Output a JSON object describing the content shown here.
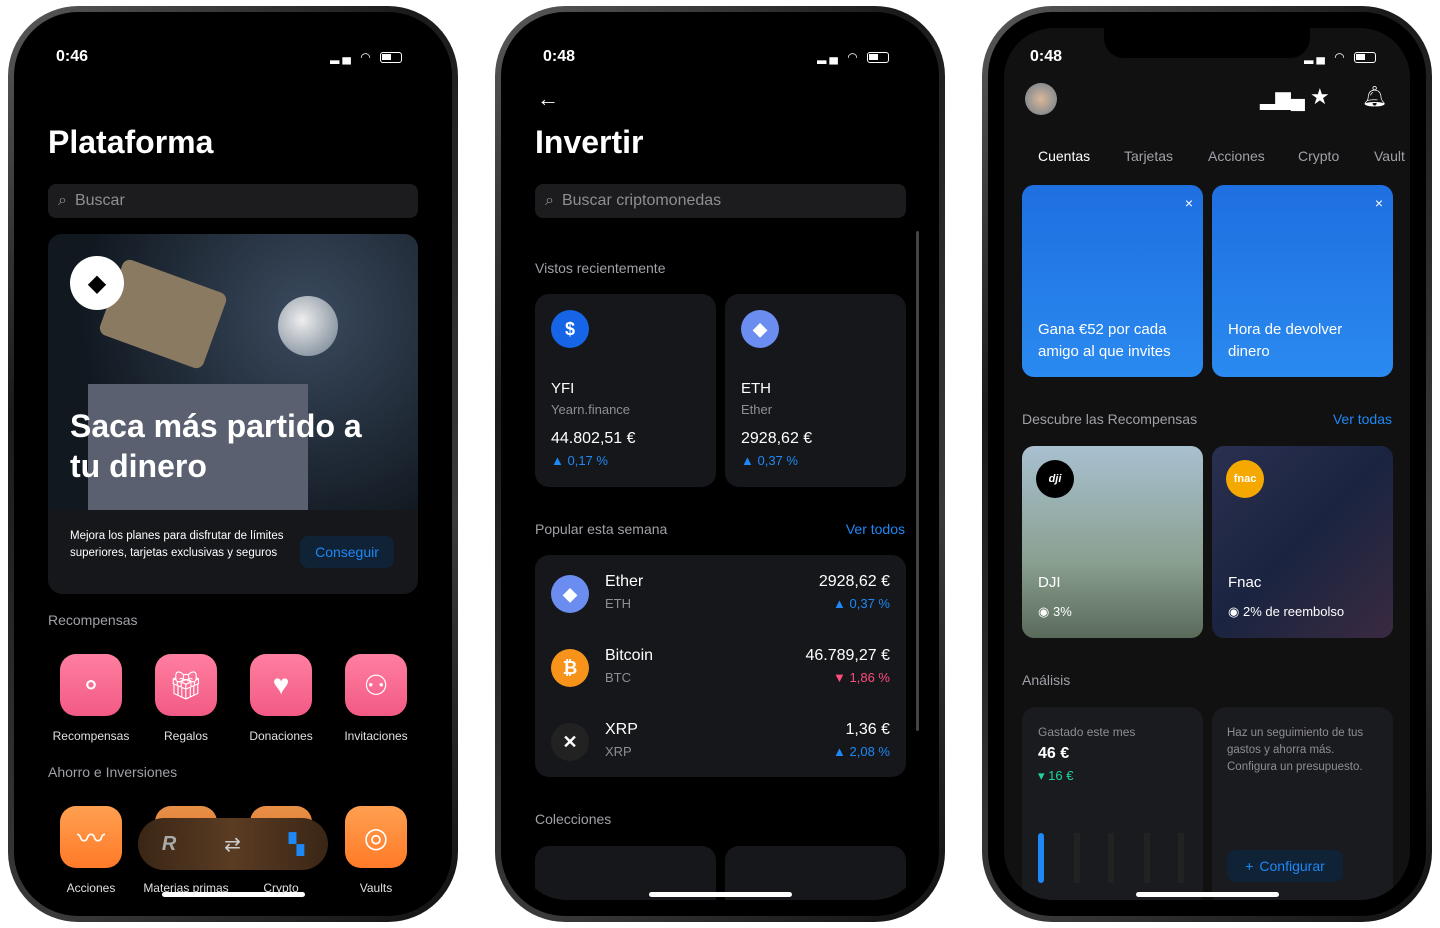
{
  "phone1": {
    "time": "0:46",
    "title": "Plataforma",
    "search_placeholder": "Buscar",
    "hero": {
      "headline": "Saca más partido a tu dinero",
      "text": "Mejora los planes para disfrutar de límites superiores, tarjetas exclusivas y seguros",
      "button": "Conseguir"
    },
    "rewards_title": "Recompensas",
    "rewards": [
      {
        "label": "Recompensas",
        "icon": "rewards-icon"
      },
      {
        "label": "Regalos",
        "icon": "gift-icon"
      },
      {
        "label": "Donaciones",
        "icon": "heart-icon"
      },
      {
        "label": "Invitaciones",
        "icon": "invite-icon"
      }
    ],
    "savings_title": "Ahorro e Inversiones",
    "savings": [
      {
        "label": "Acciones",
        "icon": "stocks-icon"
      },
      {
        "label": "Materias primas",
        "icon": "commodities-icon"
      },
      {
        "label": "Crypto",
        "icon": "crypto-icon"
      },
      {
        "label": "Vaults",
        "icon": "vault-icon"
      }
    ]
  },
  "phone2": {
    "time": "0:48",
    "title": "Invertir",
    "search_placeholder": "Buscar criptomonedas",
    "recent_title": "Vistos recientemente",
    "recent": [
      {
        "symbol": "YFI",
        "name": "Yearn.finance",
        "price": "44.802,51 €",
        "change": "0,17 %"
      },
      {
        "symbol": "ETH",
        "name": "Ether",
        "price": "2928,62 €",
        "change": "0,37 %"
      }
    ],
    "popular_title": "Popular esta semana",
    "see_all": "Ver todos",
    "popular": [
      {
        "name": "Ether",
        "symbol": "ETH",
        "price": "2928,62 €",
        "change": "0,37 %",
        "dir": "up"
      },
      {
        "name": "Bitcoin",
        "symbol": "BTC",
        "price": "46.789,27 €",
        "change": "1,86 %",
        "dir": "down"
      },
      {
        "name": "XRP",
        "symbol": "XRP",
        "price": "1,36 €",
        "change": "2,08 %",
        "dir": "up"
      }
    ],
    "collections_title": "Colecciones"
  },
  "phone3": {
    "time": "0:48",
    "tabs": [
      "Cuentas",
      "Tarjetas",
      "Acciones",
      "Crypto",
      "Vault"
    ],
    "banners": [
      "Gana €52 por cada amigo al que invites",
      "Hora de devolver dinero"
    ],
    "rewards_title": "Descubre las Recompensas",
    "see_all": "Ver todas",
    "rewards": [
      {
        "brand": "DJI",
        "logo": "dji",
        "cashback": "3%"
      },
      {
        "brand": "Fnac",
        "logo": "fnac",
        "cashback": "2% de reembolso"
      }
    ],
    "analysis_title": "Análisis",
    "spent": {
      "label": "Gastado este mes",
      "amount": "46 €",
      "delta": "16 €"
    },
    "budget": {
      "text": "Haz un seguimiento de tus gastos y ahorra más. Configura un presupuesto.",
      "button": "Configurar"
    }
  },
  "colors": {
    "accent": "#1e88f5",
    "down": "#ff4d7d",
    "positive": "#1fd69a"
  }
}
